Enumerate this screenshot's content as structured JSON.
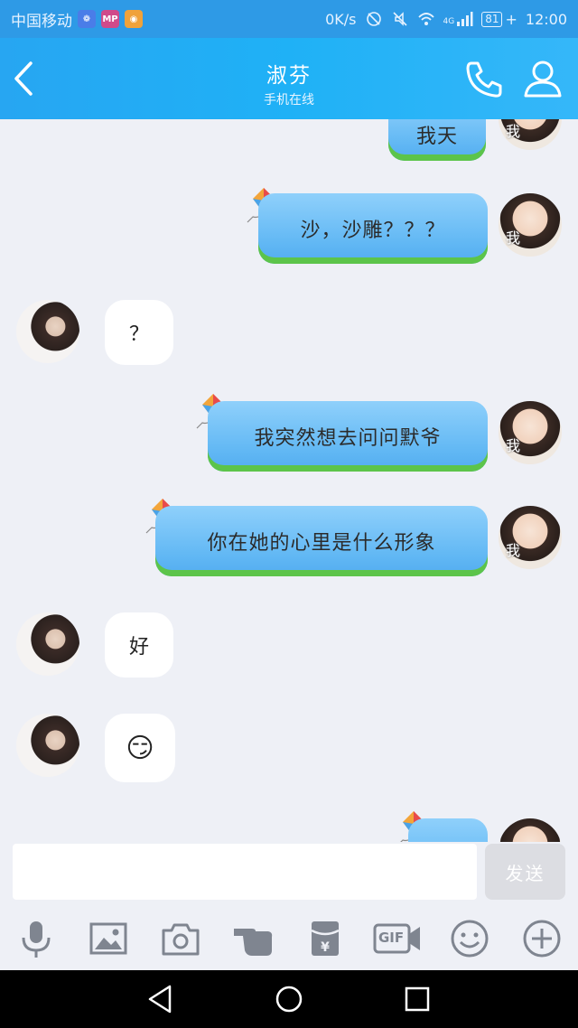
{
  "status_bar": {
    "carrier": "中国移动",
    "speed": "0K/s",
    "network": "4G",
    "battery": "81",
    "time": "12:00",
    "app_icons": [
      "baidu-paw-icon",
      "mp-app-icon",
      "weibo-icon"
    ]
  },
  "header": {
    "title": "淑芬",
    "subtitle": "手机在线"
  },
  "messages": [
    {
      "sender": "me",
      "text": "我天",
      "avatar_label": "我"
    },
    {
      "sender": "me",
      "text": "沙，沙雕？？？",
      "avatar_label": "我"
    },
    {
      "sender": "friend",
      "text": "？"
    },
    {
      "sender": "me",
      "text": "我突然想去问问默爷",
      "avatar_label": "我"
    },
    {
      "sender": "me",
      "text": "你在她的心里是什么形象",
      "avatar_label": "我"
    },
    {
      "sender": "friend",
      "text": "好"
    },
    {
      "sender": "friend",
      "text": "😏",
      "emoji_name": "smirk-emoji"
    },
    {
      "sender": "me",
      "text": "",
      "avatar_label": ""
    }
  ],
  "input": {
    "placeholder": "",
    "send_label": "发送"
  },
  "toolbar": {
    "items": [
      "microphone-icon",
      "image-icon",
      "camera-icon",
      "poke-hand-icon",
      "red-packet-icon",
      "gif-icon",
      "emoji-icon",
      "plus-icon"
    ],
    "gif_label": "GIF"
  },
  "colors": {
    "header": "#27a6f2",
    "bubble_me": "#62b8f4",
    "bubble_me_grass": "#5cc44a",
    "background": "#eef0f6",
    "send_disabled": "#dcdde2"
  }
}
